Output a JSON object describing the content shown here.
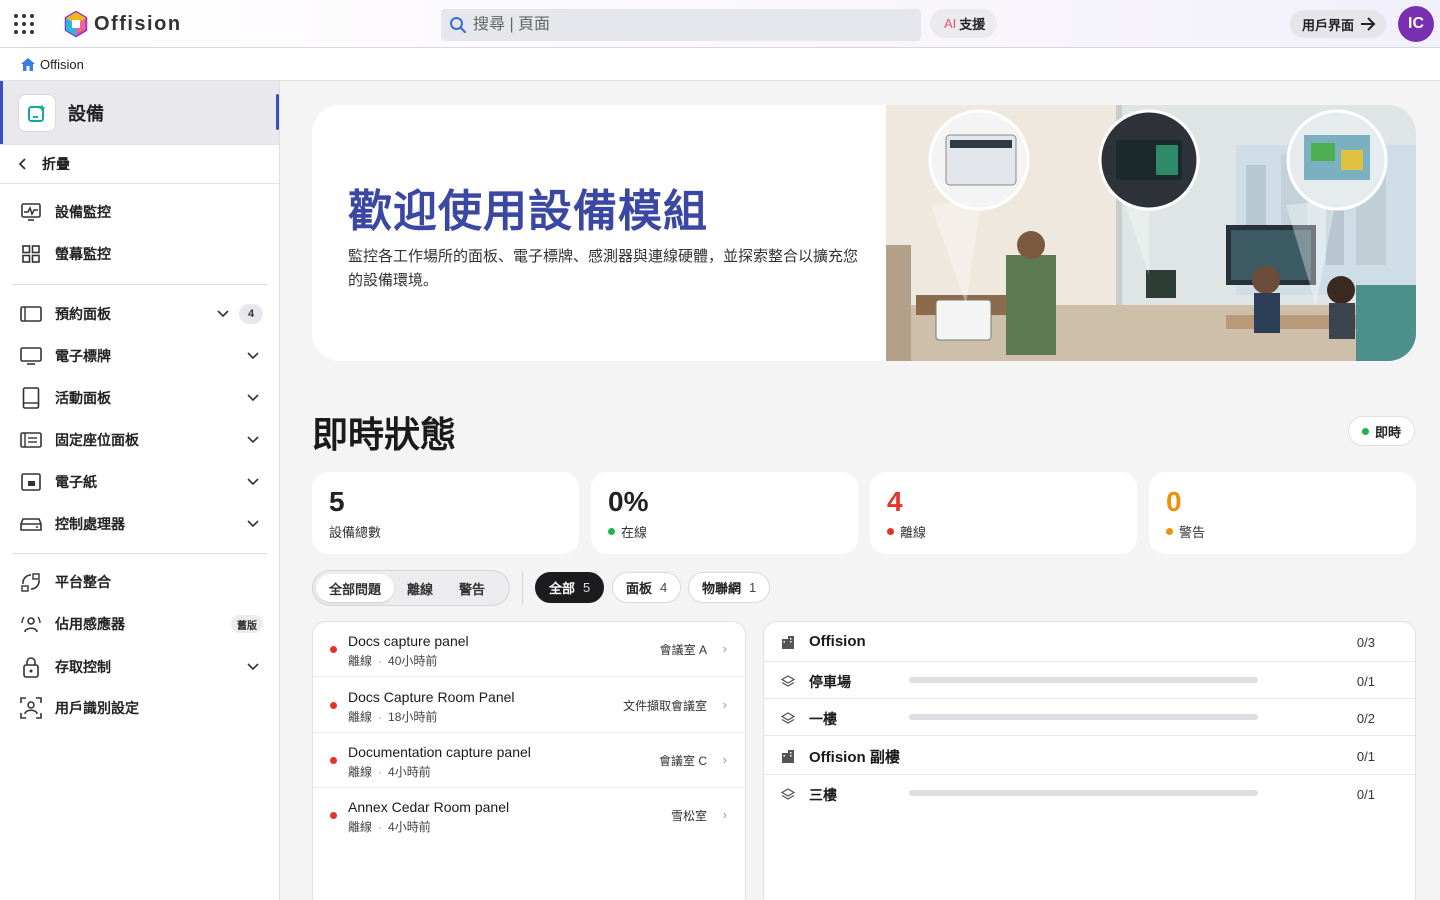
{
  "brand": {
    "name": "Offision"
  },
  "search": {
    "placeholder": "搜尋 | 頁面"
  },
  "topbar": {
    "ai_prefix": "AI",
    "ai_label": "支援",
    "user_ui_label": "用戶界面",
    "avatar_initials": "IC"
  },
  "breadcrumb": {
    "home_label": "Offision"
  },
  "sidebar": {
    "title": "設備",
    "collapse_label": "折疊",
    "items": [
      {
        "label": "設備監控",
        "icon": "monitoring-icon"
      },
      {
        "label": "螢幕監控",
        "icon": "grid-icon"
      },
      {
        "label": "預約面板",
        "icon": "panel-icon",
        "badge": "4"
      },
      {
        "label": "電子標牌",
        "icon": "display-icon"
      },
      {
        "label": "活動面板",
        "icon": "tablet-icon"
      },
      {
        "label": "固定座位面板",
        "icon": "seat-panel-icon"
      },
      {
        "label": "電子紙",
        "icon": "epaper-icon"
      },
      {
        "label": "控制處理器",
        "icon": "processor-icon"
      },
      {
        "label": "平台整合",
        "icon": "integration-icon"
      },
      {
        "label": "佔用感應器",
        "icon": "occupancy-icon",
        "tag": "舊版"
      },
      {
        "label": "存取控制",
        "icon": "lock-icon"
      },
      {
        "label": "用戶識別設定",
        "icon": "user-scan-icon"
      }
    ]
  },
  "hero": {
    "title": "歡迎使用設備模組",
    "description": "監控各工作場所的面板、電子標牌、感測器與連線硬體，並探索整合以擴充您的設備環境。"
  },
  "status": {
    "title": "即時狀態",
    "live_label": "即時",
    "colors": {
      "online": "#22b14c",
      "offline": "#e5332a",
      "warning": "#f0900c"
    },
    "cards": [
      {
        "value": "5",
        "label": "設備總數"
      },
      {
        "value": "0%",
        "label": "在線"
      },
      {
        "value": "4",
        "label": "離線"
      },
      {
        "value": "0",
        "label": "警告"
      }
    ]
  },
  "filters": {
    "segments": [
      "全部問題",
      "離線",
      "警告"
    ],
    "chips": [
      {
        "label": "全部",
        "count": "5"
      },
      {
        "label": "面板",
        "count": "4"
      },
      {
        "label": "物聯網",
        "count": "1"
      }
    ]
  },
  "issues": [
    {
      "name": "Docs capture panel",
      "status": "離線",
      "time": "40小時前",
      "room": "會議室 A"
    },
    {
      "name": "Docs Capture Room Panel",
      "status": "離線",
      "time": "18小時前",
      "room": "文件擷取會議室"
    },
    {
      "name": "Documentation capture panel",
      "status": "離線",
      "time": "4小時前",
      "room": "會議室 C"
    },
    {
      "name": "Annex Cedar Room panel",
      "status": "離線",
      "time": "4小時前",
      "room": "雪松室"
    }
  ],
  "locations": [
    {
      "name": "Offision",
      "type": "building",
      "online_fraction": 0,
      "frac": "0/3"
    },
    {
      "name": "停車場",
      "type": "floor",
      "online_fraction": 0,
      "frac": "0/1"
    },
    {
      "name": "一樓",
      "type": "floor",
      "online_fraction": 0,
      "frac": "0/2"
    },
    {
      "name": "Offision 副樓",
      "type": "building",
      "online_fraction": 0,
      "frac": "0/1"
    },
    {
      "name": "三樓",
      "type": "floor",
      "online_fraction": 0,
      "frac": "0/1"
    }
  ]
}
